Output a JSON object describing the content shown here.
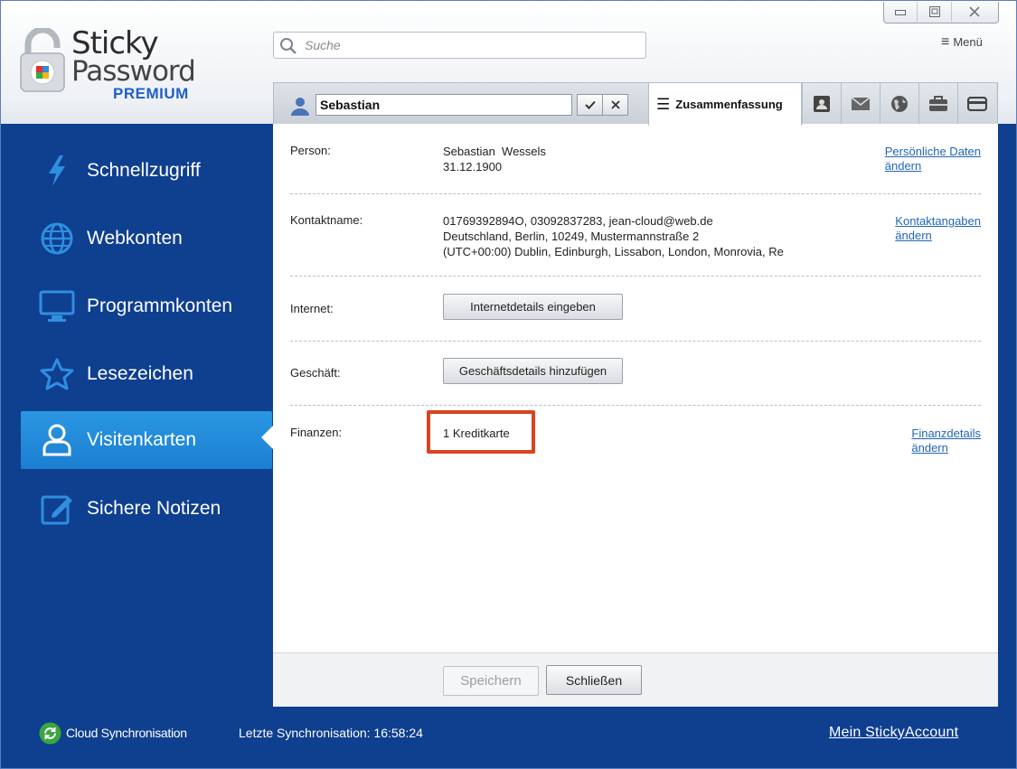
{
  "app": {
    "logo_line1": "Sticky",
    "logo_line2": "Password",
    "logo_line3": "PREMIUM"
  },
  "search": {
    "placeholder": "Suche"
  },
  "window_controls": [
    "minimize",
    "restore",
    "close"
  ],
  "menu": {
    "label": "Menü"
  },
  "sidebar": {
    "items": [
      {
        "label": "Schnellzugriff",
        "icon": "lightning-icon"
      },
      {
        "label": "Webkonten",
        "icon": "globe-icon"
      },
      {
        "label": "Programmkonten",
        "icon": "monitor-icon"
      },
      {
        "label": "Lesezeichen",
        "icon": "star-icon"
      },
      {
        "label": "Visitenkarten",
        "icon": "person-icon",
        "active": true
      },
      {
        "label": "Sichere Notizen",
        "icon": "note-edit-icon"
      }
    ]
  },
  "record": {
    "name": "Sebastian",
    "ok_icon": "checkmark-icon",
    "cancel_icon": "x-icon"
  },
  "tabs": {
    "summary_label": "Zusammenfassung",
    "icons": [
      "contact-card-icon",
      "envelope-icon",
      "globe-icon",
      "briefcase-icon",
      "credit-card-icon"
    ]
  },
  "summary": {
    "person": {
      "label": "Person:",
      "name": "Sebastian  Wessels",
      "date": "31.12.1900",
      "link_line1": "Persönliche Daten",
      "link_line2": "ändern"
    },
    "contact": {
      "label": "Kontaktname:",
      "line1": "01769392894O, 03092837283, jean-cloud@web.de",
      "line2": "Deutschland, Berlin, 10249, Mustermannstraße 2",
      "line3": "(UTC+00:00) Dublin, Edinburgh, Lissabon, London, Monrovia, Re",
      "link_line1": "Kontaktangaben",
      "link_line2": "ändern"
    },
    "internet": {
      "label": "Internet:",
      "button": "Internetdetails eingeben"
    },
    "business": {
      "label": "Geschäft:",
      "button": "Geschäftsdetails hinzufügen"
    },
    "finance": {
      "label": "Finanzen:",
      "value": "1 Kreditkarte",
      "link_line1": "Finanzdetails",
      "link_line2": "ändern"
    }
  },
  "footer": {
    "save": "Speichern",
    "close": "Schließen"
  },
  "status": {
    "sync_label": "Cloud Synchronisation",
    "last_sync": "Letzte Synchronisation: 16:58:24",
    "account_link": "Mein StickyAccount"
  },
  "colors": {
    "sidebar_bg": "#0f3f8f",
    "active_item": "#2a97e3",
    "link": "#2166b8",
    "highlight": "#d9431e",
    "brand": "#1f5fc8"
  }
}
